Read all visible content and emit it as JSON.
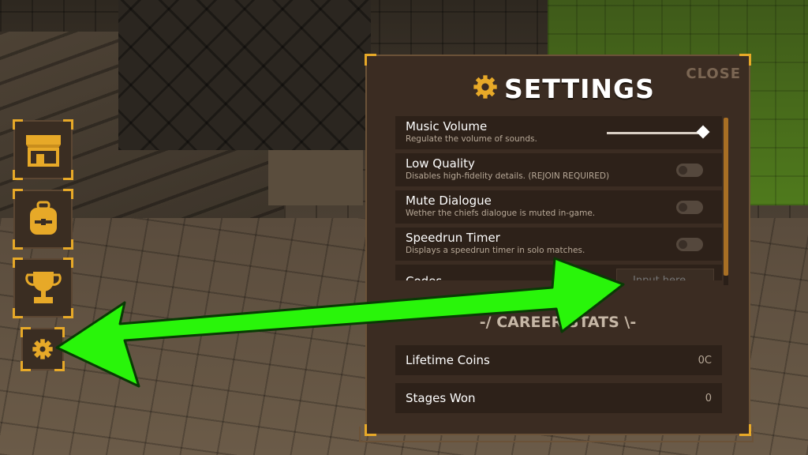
{
  "settings": {
    "title": "SETTINGS",
    "close_label": "CLOSE",
    "options": [
      {
        "label": "Music Volume",
        "desc": "Regulate the volume of sounds.",
        "control": "slider",
        "value": 1.0
      },
      {
        "label": "Low Quality",
        "desc": "Disables high-fidelity details. (REJOIN REQUIRED)",
        "control": "toggle",
        "value": false
      },
      {
        "label": "Mute Dialogue",
        "desc": "Wether the chiefs dialogue is muted in-game.",
        "control": "toggle",
        "value": false
      },
      {
        "label": "Speedrun Timer",
        "desc": "Displays a speedrun timer in solo matches.",
        "control": "toggle",
        "value": false
      },
      {
        "label": "Codes",
        "placeholder": "Input here..",
        "control": "input"
      }
    ]
  },
  "career": {
    "title": "-/ CAREER STATS \\-",
    "stats": [
      {
        "label": "Lifetime Coins",
        "value": "0C"
      },
      {
        "label": "Stages Won",
        "value": "0"
      }
    ]
  },
  "side_menu": [
    {
      "icon": "shop-icon"
    },
    {
      "icon": "backpack-icon"
    },
    {
      "icon": "trophy-icon"
    },
    {
      "icon": "gear-icon"
    }
  ],
  "colors": {
    "accent": "#e7a928",
    "panel": "#3b2c22",
    "row": "#2d2119",
    "arrow": "#29f50a"
  }
}
